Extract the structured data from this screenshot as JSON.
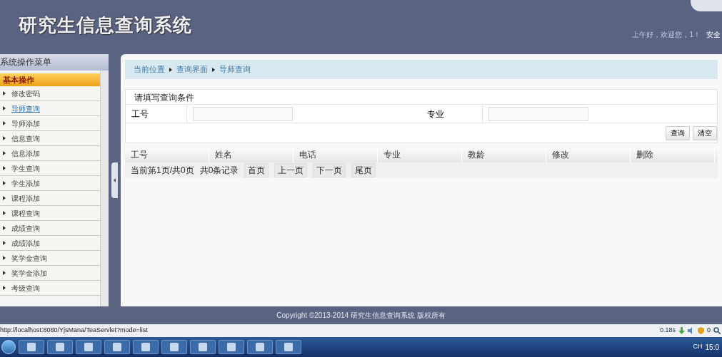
{
  "header": {
    "title": "研究生信息查询系统",
    "greeting": "上午好，欢迎您，1！",
    "security": "安全"
  },
  "sidebar": {
    "title": "系统操作菜单",
    "group": "基本操作",
    "items": [
      {
        "label": "修改密码",
        "selected": false
      },
      {
        "label": "导师查询",
        "selected": true
      },
      {
        "label": "导师添加",
        "selected": false
      },
      {
        "label": "信息查询",
        "selected": false
      },
      {
        "label": "信息添加",
        "selected": false
      },
      {
        "label": "学生查询",
        "selected": false
      },
      {
        "label": "学生添加",
        "selected": false
      },
      {
        "label": "课程添加",
        "selected": false
      },
      {
        "label": "课程查询",
        "selected": false
      },
      {
        "label": "成绩查询",
        "selected": false
      },
      {
        "label": "成绩添加",
        "selected": false
      },
      {
        "label": "奖学金查询",
        "selected": false
      },
      {
        "label": "奖学金添加",
        "selected": false
      },
      {
        "label": "考级查询",
        "selected": false
      }
    ]
  },
  "breadcrumb": [
    "当前位置",
    "查询界面",
    "导师查询"
  ],
  "search_form": {
    "title": "请填写查询条件",
    "fields": [
      {
        "label": "工号"
      },
      {
        "label": "专业"
      }
    ],
    "buttons": [
      "查询",
      "清空"
    ]
  },
  "table": {
    "columns": [
      "工号",
      "姓名",
      "电话",
      "专业",
      "教龄",
      "修改",
      "删除"
    ]
  },
  "pager": {
    "info": "当前第1页/共0页",
    "count": "共0条记录",
    "buttons": [
      "首页",
      "上一页",
      "下一页",
      "尾页"
    ]
  },
  "footer": "Copyright ©2013-2014 研究生信息查询系统 版权所有",
  "status_bar": {
    "url": "http://localhost:8080/YjsMana/TeaServlet?mode=list",
    "timing": "0.18s",
    "count": "0"
  },
  "taskbar": {
    "lang": "CH",
    "time": "15:0"
  }
}
